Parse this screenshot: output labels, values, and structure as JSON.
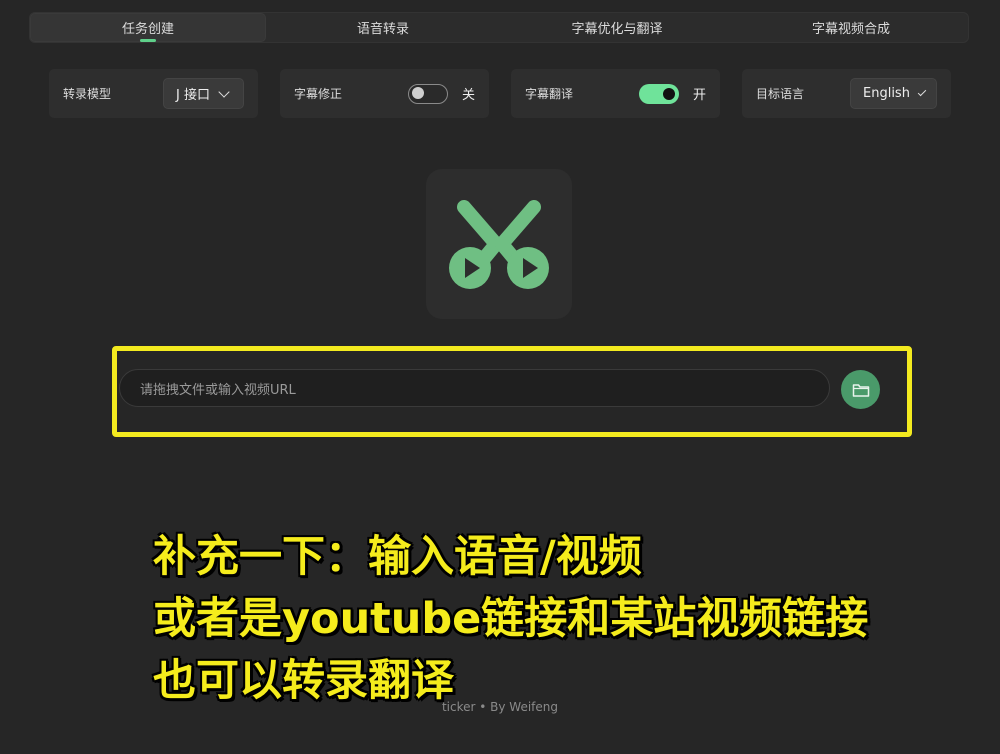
{
  "tabs": [
    {
      "label": "任务创建",
      "active": true
    },
    {
      "label": "语音转录",
      "active": false
    },
    {
      "label": "字幕优化与翻译",
      "active": false
    },
    {
      "label": "字幕视频合成",
      "active": false
    }
  ],
  "settings": {
    "model": {
      "label": "转录模型",
      "value": "J 接口"
    },
    "correction": {
      "label": "字幕修正",
      "state": "关",
      "enabled": false
    },
    "translation": {
      "label": "字幕翻译",
      "state": "开",
      "enabled": true
    },
    "target_language": {
      "label": "目标语言",
      "value": "English"
    }
  },
  "input": {
    "placeholder": "请拖拽文件或输入视频URL"
  },
  "caption": {
    "line1": "补充一下：输入语音/视频",
    "line2": "或者是youtube链接和某站视频链接",
    "line3": "也可以转录翻译"
  },
  "footer": {
    "text": "ticker • By Weifeng"
  },
  "colors": {
    "accent": "#5fd08a",
    "highlight": "#f3ea1f",
    "caption": "#f5ec1c",
    "logo_green": "#6fbf83"
  },
  "icons": {
    "logo": "scissors-play-icon",
    "browse": "folder-icon",
    "dropdown": "chevron-down-icon"
  }
}
